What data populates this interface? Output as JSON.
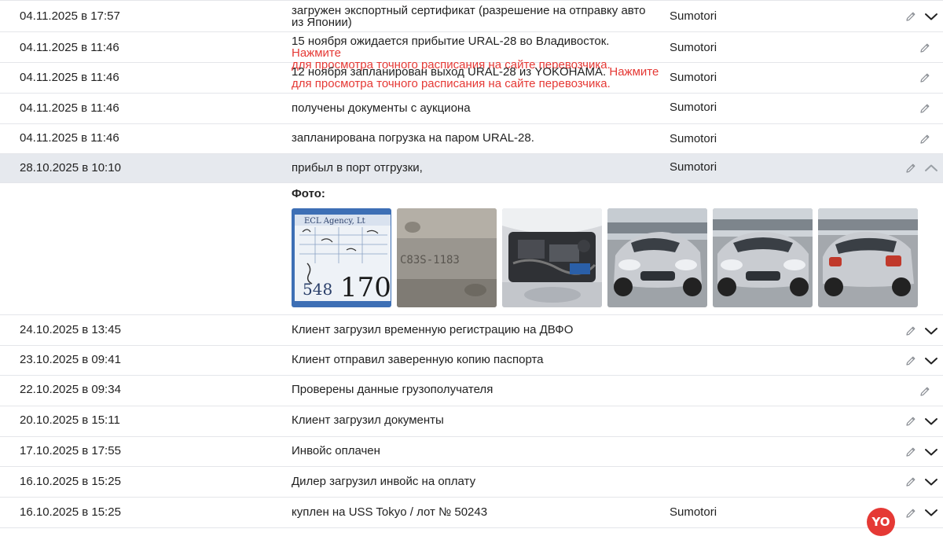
{
  "events": [
    {
      "date": "04.11.2025 в 17:57",
      "text": "загружен экспортный сертификат (разрешение на отправку авто",
      "text2": "из Японии)",
      "author": "Sumotori",
      "chevron": "down"
    },
    {
      "date": "04.11.2025 в 11:46",
      "text": "15 ноября ожидается прибытие URAL-28 во Владивосток.",
      "link1": "Нажмите",
      "link2": "для просмотра точного расписания на сайте перевозчика.",
      "author": "Sumotori"
    },
    {
      "date": "04.11.2025 в 11:46",
      "text": "12 ноября запланирован выход URAL-28 из YOKOHAMA.",
      "link1": "Нажмите",
      "link2": "для просмотра точного расписания на сайте перевозчика.",
      "author": "Sumotori"
    },
    {
      "date": "04.11.2025 в 11:46",
      "text": "получены документы с аукциона",
      "author": "Sumotori"
    },
    {
      "date": "04.11.2025 в 11:46",
      "text": "запланирована погрузка на паром URAL-28.",
      "author": "Sumotori"
    },
    {
      "date": "28.10.2025 в 10:10",
      "text": "прибыл в порт отгрузки,",
      "author": "Sumotori",
      "chevron": "up"
    },
    {
      "date": "24.10.2025 в 13:45",
      "text": "Клиент загрузил временную регистрацию на ДВФО",
      "chevron": "down"
    },
    {
      "date": "23.10.2025 в 09:41",
      "text": "Клиент отправил заверенную копию паспорта",
      "chevron": "down"
    },
    {
      "date": "22.10.2025 в 09:34",
      "text": "Проверены данные грузополучателя"
    },
    {
      "date": "20.10.2025 в 15:11",
      "text": "Клиент загрузил документы",
      "chevron": "down"
    },
    {
      "date": "17.10.2025 в 17:55",
      "text": "Инвойс оплачен",
      "chevron": "down"
    },
    {
      "date": "16.10.2025 в 15:25",
      "text": "Дилер загрузил инвойс на оплату",
      "chevron": "down"
    },
    {
      "date": "16.10.2025 в 15:25",
      "text": "куплен на USS Tokyo / лот № 50243",
      "author": "Sumotori",
      "chevron": "down"
    }
  ],
  "photos": {
    "label": "Фото:",
    "items": [
      {
        "kind": "auction-sheet",
        "text_top": "ECL Agency, Lt",
        "text_num": "548",
        "text_big": "170"
      },
      {
        "kind": "chassis-number",
        "text": "C83S-1183"
      },
      {
        "kind": "engine-bay"
      },
      {
        "kind": "car-front-left"
      },
      {
        "kind": "car-front-right"
      },
      {
        "kind": "car-rear"
      }
    ]
  },
  "colors": {
    "link": "#e53935",
    "active_row": "#e6e9ee",
    "border": "#e4e6ea",
    "car": "#c9ccd1",
    "badge": "#e53935"
  },
  "badge": {
    "label": "YO"
  }
}
